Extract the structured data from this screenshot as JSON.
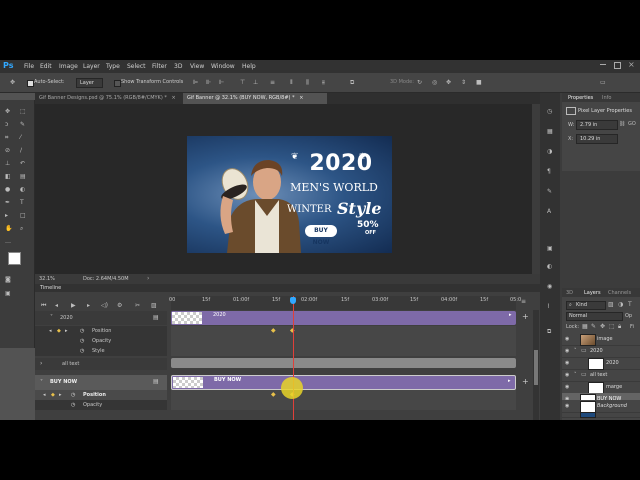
{
  "menubar": {
    "logo": "Ps",
    "items": [
      "File",
      "Edit",
      "Image",
      "Layer",
      "Type",
      "Select",
      "Filter",
      "3D",
      "View",
      "Window",
      "Help"
    ]
  },
  "options": {
    "auto_select_label": "Auto-Select:",
    "auto_select_value": "Layer",
    "show_transform_label": "Show Transform Controls",
    "mode_3d_label": "3D Mode:"
  },
  "tabs": [
    {
      "label": "Gif Banner Designs.psd @ 75.1% (RGB/8#/CMYK) *",
      "close": "×",
      "active": false
    },
    {
      "label": "Gif Banner @ 32.1% (BUY NOW, RGB/8#) *",
      "close": "×",
      "active": true
    }
  ],
  "banner": {
    "year": "2020",
    "mens_world": "MEN'S WORLD",
    "winter": "WINTER",
    "style": "Style",
    "discount": "50%",
    "off": "OFF",
    "button": "BUY NOW"
  },
  "status": {
    "zoom": "32.1%",
    "doc": "Doc: 2.64M/4.50M"
  },
  "timeline": {
    "title": "Timeline",
    "ruler_labels": [
      "00",
      "15f",
      "01:00f",
      "15f",
      "02:00f",
      "15f",
      "03:00f",
      "15f",
      "04:00f",
      "15f",
      "05:0"
    ],
    "rows": [
      {
        "name": "2020",
        "kind": "group"
      },
      {
        "name": "Position",
        "kind": "prop"
      },
      {
        "name": "Opacity",
        "kind": "prop"
      },
      {
        "name": "Style",
        "kind": "prop"
      },
      {
        "name": "all text",
        "kind": "group"
      },
      {
        "name": "BUY NOW",
        "kind": "layer"
      },
      {
        "name": "Position",
        "kind": "prop"
      },
      {
        "name": "Opacity",
        "kind": "prop"
      }
    ],
    "clip_labels": [
      "2020",
      "BUY NOW"
    ]
  },
  "properties": {
    "tab1": "Properties",
    "tab2": "Info",
    "subtitle": "Pixel Layer Properties",
    "w_label": "W:",
    "w_value": "2.79 in",
    "x_label": "X:",
    "x_value": "10.29 in",
    "go_label": "GO"
  },
  "layers_panel": {
    "tabs": [
      "3D",
      "Layers",
      "Channels"
    ],
    "kind_value": "Kind",
    "blend_value": "Normal",
    "opacity_label": "Op",
    "lock_label": "Lock:",
    "fill_label": "Fi",
    "layers": [
      {
        "name": "image",
        "indent": 0,
        "type": "layer"
      },
      {
        "name": "2020",
        "indent": 0,
        "type": "folder"
      },
      {
        "name": "2020",
        "indent": 1,
        "type": "layer"
      },
      {
        "name": "all text",
        "indent": 0,
        "type": "folder"
      },
      {
        "name": "marge",
        "indent": 1,
        "type": "layer"
      },
      {
        "name": "BUY NOW",
        "indent": 0,
        "type": "layer",
        "selected": true
      },
      {
        "name": "bg",
        "indent": 0,
        "type": "layer"
      },
      {
        "name": "Background",
        "indent": 0,
        "type": "layer",
        "italic": true
      }
    ]
  },
  "colors": {
    "accent": "#31a8ff",
    "clip_purple": "#7e6aa8",
    "playhead": "#e0403a",
    "keyframe": "#e8c04a",
    "banner_bg": "#17375e"
  }
}
